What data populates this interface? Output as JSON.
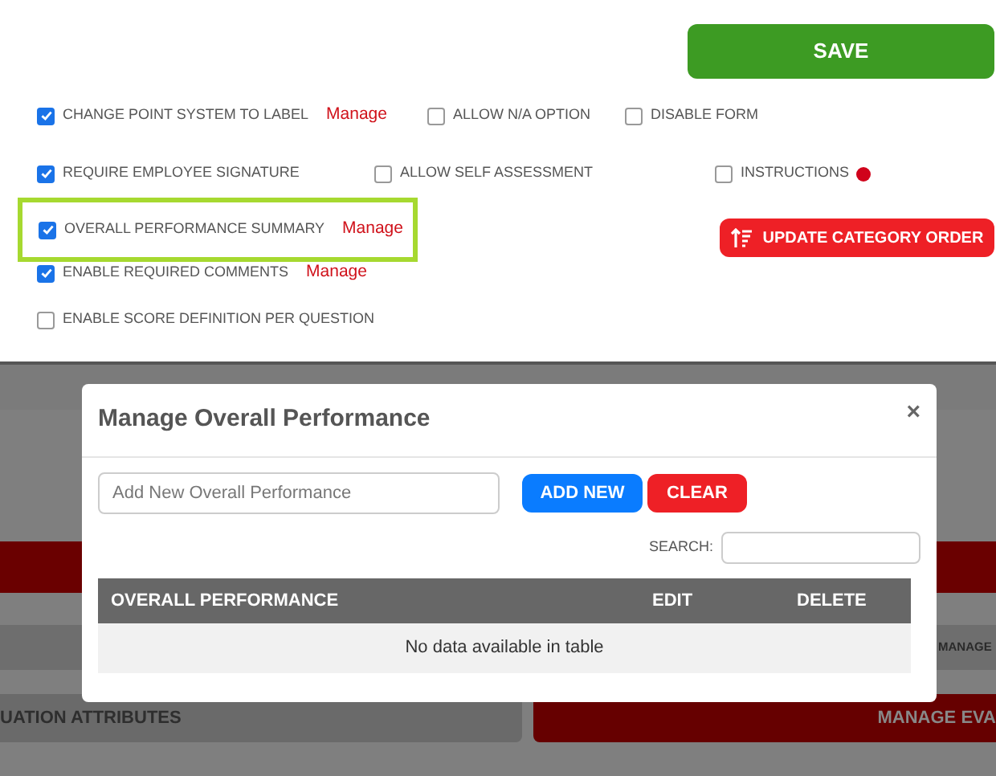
{
  "save_button": "SAVE",
  "option_rows": [
    {
      "highlighted": false,
      "options": [
        {
          "label": "CHANGE POINT SYSTEM TO LABEL",
          "checked": true,
          "manage_link": "Manage"
        },
        {
          "label": "ALLOW N/A OPTION",
          "checked": false
        },
        {
          "label": "DISABLE FORM",
          "checked": false
        }
      ]
    },
    {
      "highlighted": false,
      "options": [
        {
          "label": "REQUIRE EMPLOYEE SIGNATURE",
          "checked": true
        },
        {
          "label": "ALLOW SELF ASSESSMENT",
          "checked": false
        },
        {
          "label": "INSTRUCTIONS",
          "checked": false,
          "info_icon": true
        }
      ]
    },
    {
      "highlighted": true,
      "options": [
        {
          "label": "OVERALL PERFORMANCE SUMMARY",
          "checked": true,
          "manage_link": "Manage"
        }
      ]
    },
    {
      "highlighted": false,
      "options": [
        {
          "label": "ENABLE REQUIRED COMMENTS",
          "checked": true,
          "manage_link": "Manage"
        }
      ]
    },
    {
      "highlighted": false,
      "options": [
        {
          "label": "ENABLE SCORE DEFINITION PER QUESTION",
          "checked": false
        }
      ]
    }
  ],
  "update_category_order_button": "UPDATE CATEGORY ORDER",
  "background": {
    "bar_label": "MANAGE",
    "left_button": "UATION ATTRIBUTES",
    "right_button": "MANAGE EVA"
  },
  "modal": {
    "title": "Manage Overall Performance",
    "close": "×",
    "input_placeholder": "Add New Overall Performance",
    "add_button": "ADD NEW",
    "clear_button": "CLEAR",
    "search_label": "SEARCH:",
    "table": {
      "columns": [
        "OVERALL PERFORMANCE",
        "EDIT",
        "DELETE"
      ],
      "empty_message": "No data available in table"
    }
  }
}
